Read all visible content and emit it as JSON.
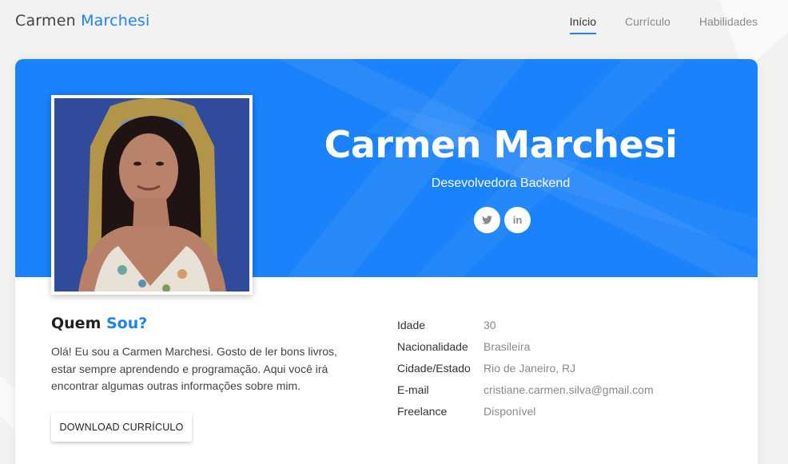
{
  "brand": {
    "first": "Carmen",
    "last": "Marchesi"
  },
  "nav": {
    "items": [
      {
        "label": "Início",
        "active": true
      },
      {
        "label": "Currículo",
        "active": false
      },
      {
        "label": "Habilidades",
        "active": false
      }
    ]
  },
  "hero": {
    "name": "Carmen Marchesi",
    "role": "Desevolvedora Backend",
    "socials": [
      {
        "icon": "twitter-icon",
        "glyph": "🐦"
      },
      {
        "icon": "linkedin-icon",
        "glyph": "in"
      }
    ]
  },
  "about": {
    "title_first": "Quem",
    "title_accent": "Sou?",
    "text": "Olá! Eu sou a Carmen Marchesi. Gosto de ler bons livros, estar sempre aprendendo e programação. Aqui você irá encontrar algumas outras informações sobre mim.",
    "download_label": "DOWNLOAD CURRÍCULO"
  },
  "info": [
    {
      "label": "Idade",
      "value": "30"
    },
    {
      "label": "Nacionalidade",
      "value": "Brasileira"
    },
    {
      "label": "Cidade/Estado",
      "value": "Rio de Janeiro, RJ"
    },
    {
      "label": "E-mail",
      "value": "cristiane.carmen.silva@gmail.com"
    },
    {
      "label": "Freelance",
      "value": "Disponível"
    }
  ],
  "colors": {
    "accent": "#1c82f4",
    "hero_bg": "#1a82fa"
  }
}
